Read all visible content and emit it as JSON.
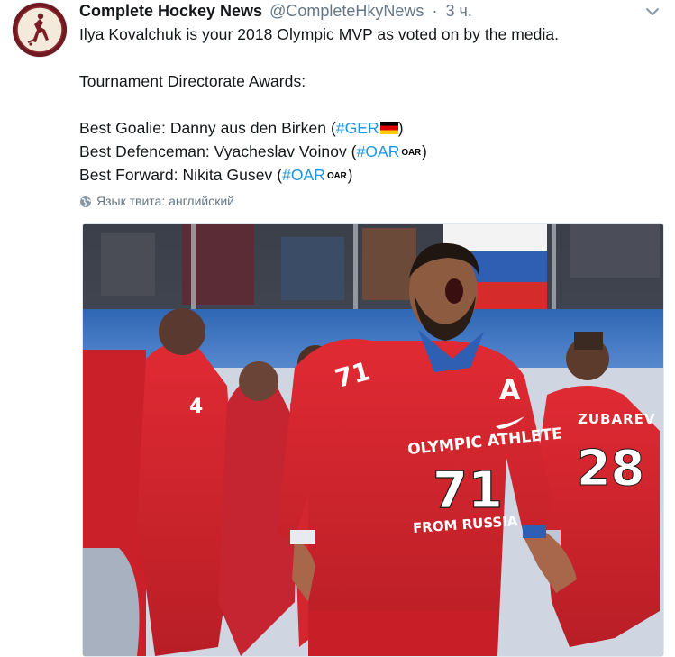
{
  "author": {
    "name": "Complete Hockey News",
    "handle": "@CompleteHkyNews",
    "separator": "·",
    "time": "3 ч."
  },
  "tweet": {
    "line1": "Ilya Kovalchuk is your 2018 Olympic MVP as voted on by the media.",
    "line2": "Tournament Directorate Awards:",
    "goalie_label": "Best Goalie: Danny aus den Birken (",
    "goalie_tag": "#GER",
    "goalie_close": ")",
    "defence_label": "Best Defenceman: Vyacheslav Voinov (",
    "defence_tag": "#OAR",
    "defence_emoji": "OAR",
    "defence_close": ")",
    "forward_label": "Best Forward: Nikita Gusev (",
    "forward_tag": "#OAR",
    "forward_emoji": "OAR",
    "forward_close": ")"
  },
  "translate_label": "Язык твита: английский",
  "photo": {
    "jersey_front_line1": "OLYMPIC ATHLETE",
    "jersey_front_number": "71",
    "jersey_front_line2": "FROM RUSSIA",
    "jersey_captain": "A",
    "jersey_shoulder": "71",
    "right_player_name": "ZUBAREV",
    "right_player_number": "28",
    "left_player_number": "4"
  },
  "colors": {
    "link": "#1b95e0",
    "secondary_text": "#657786",
    "jersey_red": "#d8262f"
  }
}
